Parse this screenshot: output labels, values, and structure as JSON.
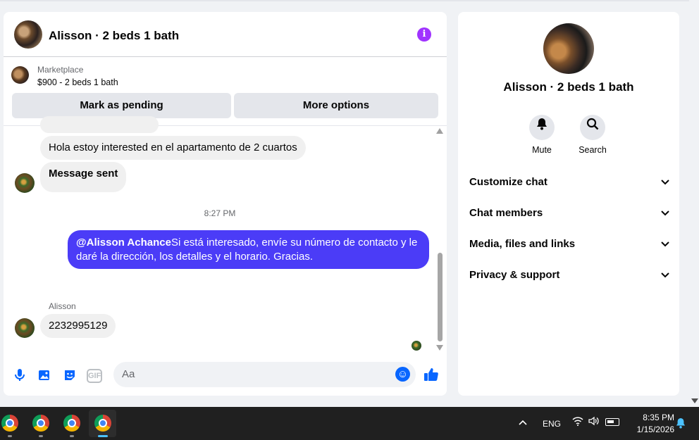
{
  "chat": {
    "title": "Alisson · 2 beds 1 bath",
    "info_icon": "i",
    "listing": {
      "source": "Marketplace",
      "price_title": "$900 - 2 beds 1 bath",
      "btn_pending": "Mark as pending",
      "btn_more": "More options"
    },
    "messages": {
      "incoming_1": "Hola estoy interested en el apartamento de 2 cuartos",
      "incoming_2": "Message sent",
      "timestamp": "8:27 PM",
      "outgoing_mention": "@Alisson Achance",
      "outgoing_text": "Si está interesado, envíe su número de contacto y le daré la dirección, los detalles y el horario. Gracias.",
      "sender_name": "Alisson",
      "incoming_3": "2232995129"
    },
    "composer": {
      "placeholder": "Aa",
      "gif_label": "GIF"
    }
  },
  "side": {
    "title": "Alisson · 2 beds 1 bath",
    "actions": [
      {
        "label": "Mute",
        "icon": "bell-icon"
      },
      {
        "label": "Search",
        "icon": "search-icon"
      }
    ],
    "sections": [
      "Customize chat",
      "Chat members",
      "Media, files and links",
      "Privacy & support"
    ]
  },
  "taskbar": {
    "apps": [
      "chrome",
      "chrome",
      "chrome",
      "chrome"
    ],
    "lang": "ENG",
    "time": "8:35 PM",
    "date": "1/15/2026"
  },
  "colors": {
    "outgoing_bubble": "#4b3cf7",
    "accent_blue": "#0866ff",
    "info_purple": "#a033ff"
  }
}
